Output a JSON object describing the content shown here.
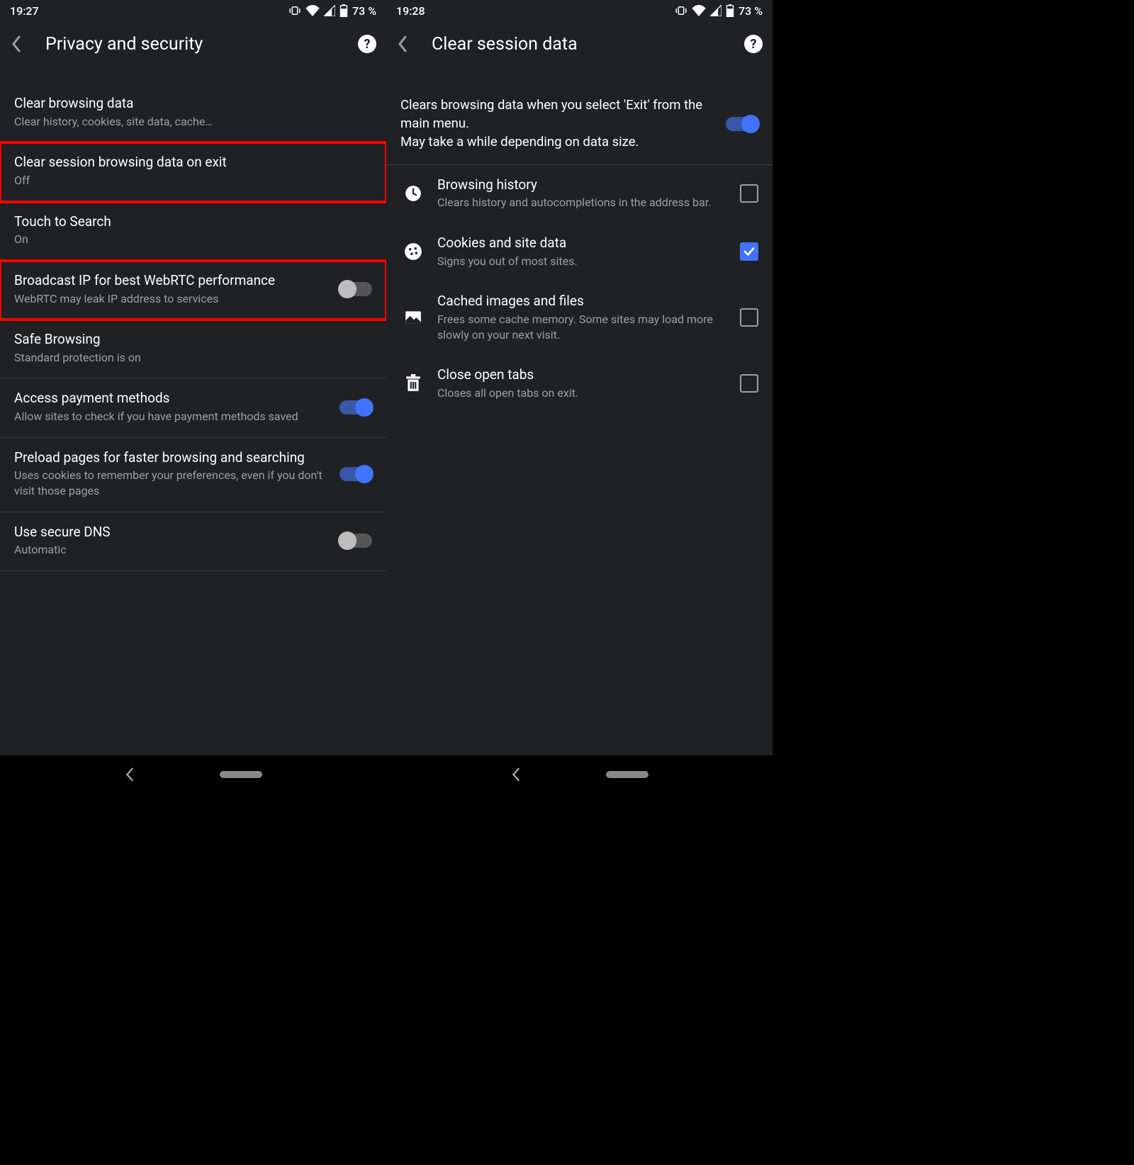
{
  "left": {
    "status": {
      "time": "19:27",
      "battery": "73 %"
    },
    "title": "Privacy and security",
    "items": [
      {
        "title": "Clear browsing data",
        "sub": "Clear history, cookies, site data, cache…"
      },
      {
        "title": "Clear session browsing data on exit",
        "sub": "Off"
      },
      {
        "title": "Touch to Search",
        "sub": "On"
      },
      {
        "title": "Broadcast IP for best WebRTC performance",
        "sub": "WebRTC may leak IP address to services"
      },
      {
        "title": "Safe Browsing",
        "sub": "Standard protection is on"
      },
      {
        "title": "Access payment methods",
        "sub": "Allow sites to check if you have payment methods saved"
      },
      {
        "title": "Preload pages for faster browsing and searching",
        "sub": "Uses cookies to remember your preferences, even if you don't visit those pages"
      },
      {
        "title": "Use secure DNS",
        "sub": "Automatic"
      }
    ]
  },
  "right": {
    "status": {
      "time": "19:28",
      "battery": "73 %"
    },
    "title": "Clear session data",
    "intro": "Clears browsing data when you select 'Exit' from the main menu.\nMay take a while depending on data size.",
    "items": [
      {
        "title": "Browsing history",
        "sub": "Clears history and autocompletions in the address bar."
      },
      {
        "title": "Cookies and site data",
        "sub": "Signs you out of most sites."
      },
      {
        "title": "Cached images and files",
        "sub": "Frees some cache memory. Some sites may load more slowly on your next visit."
      },
      {
        "title": "Close open tabs",
        "sub": "Closes all open tabs on exit."
      }
    ]
  }
}
